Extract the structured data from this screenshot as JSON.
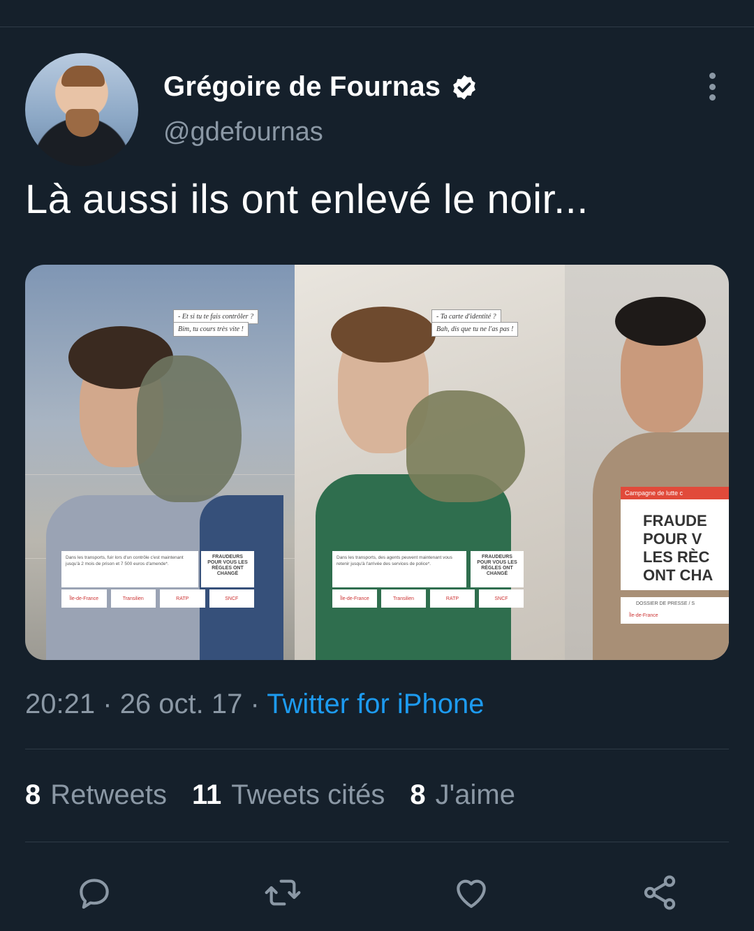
{
  "author": {
    "name": "Grégoire de Fournas",
    "handle": "@gdefournas",
    "verified": true
  },
  "tweet": {
    "text": "Là aussi ils ont enlevé le noir..."
  },
  "media": {
    "poster1": {
      "speech_line1": "- Et si tu te fais contrôler ?",
      "speech_line2": "Bim, tu cours très vite !",
      "caption": "Dans les transports, fuir lors d'un contrôle c'est maintenant jusqu'à 2 mois de prison et 7 500 euros d'amende*.",
      "slogan": "FRAUDEURS POUR VOUS LES RÈGLES ONT CHANGÉ",
      "logos": [
        "Île-de-France",
        "Transilien",
        "RATP",
        "SNCF"
      ]
    },
    "poster2": {
      "speech_line1": "- Ta carte d'identité ?",
      "speech_line2": "Bah, dis que tu ne l'as pas !",
      "caption": "Dans les transports, des agents peuvent maintenant vous retenir jusqu'à l'arrivée des services de police*.",
      "slogan": "FRAUDEURS POUR VOUS LES RÈGLES ONT CHANGÉ",
      "logos": [
        "Île-de-France",
        "Transilien",
        "RATP",
        "SNCF"
      ]
    },
    "poster3": {
      "header": "Campagne de lutte c",
      "lines": [
        "FRAUDE",
        "POUR V",
        "LES RÈC",
        "ONT CHA"
      ],
      "dossier": "DOSSIER DE PRESSE / S",
      "logos": "Île-de-France"
    }
  },
  "meta": {
    "time": "20:21",
    "date": "26 oct. 17",
    "separator": "·",
    "source": "Twitter for iPhone"
  },
  "stats": {
    "retweets_count": "8",
    "retweets_label": "Retweets",
    "quotes_count": "11",
    "quotes_label": "Tweets cités",
    "likes_count": "8",
    "likes_label": "J'aime"
  },
  "colors": {
    "background": "#15202b",
    "accent": "#1d9bf0",
    "muted": "#8b98a5",
    "divider": "#2f3b47"
  },
  "icons": [
    "verified-badge-icon",
    "more-vertical-icon",
    "reply-icon",
    "retweet-icon",
    "like-icon",
    "share-icon"
  ]
}
